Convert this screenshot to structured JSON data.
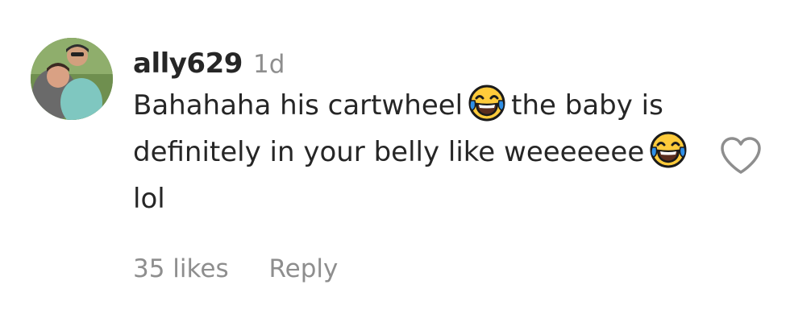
{
  "comment": {
    "username": "ally629",
    "timestamp": "1d",
    "text_parts": {
      "part1": "Bahahaha his cartwheel",
      "part2": "the baby is definitely in your belly like weeeeeee",
      "part3": "lol"
    },
    "emoji": "face-with-tears-of-joy",
    "likes_label": "35 likes",
    "reply_label": "Reply",
    "like_icon": "heart-outline-icon",
    "colors": {
      "text": "#262626",
      "secondary": "#8e8e8e",
      "background": "#ffffff"
    }
  }
}
